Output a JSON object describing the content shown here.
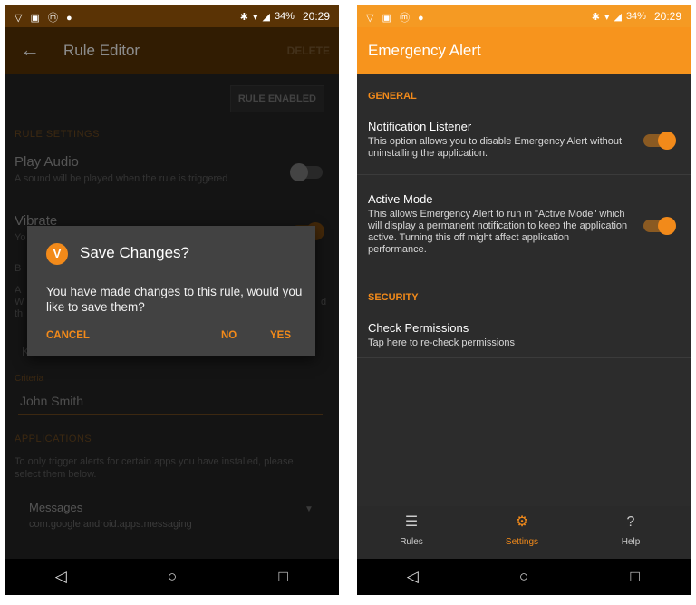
{
  "left": {
    "status": {
      "left_icons": "▽ ▣ ⓜ ●",
      "battery": "34%",
      "time": "20:29"
    },
    "appbar": {
      "title": "Rule Editor",
      "action": "DELETE"
    },
    "rule_enabled": "RULE ENABLED",
    "rule_settings_head": "RULE SETTINGS",
    "play_audio": {
      "title": "Play Audio",
      "sub": "A sound will be played when the rule is triggered"
    },
    "vibrate": {
      "title": "Vibrate"
    },
    "criteria": {
      "label": "Criteria",
      "value": "John Smith"
    },
    "applications": {
      "head": "APPLICATIONS",
      "desc": "To only trigger alerts for certain apps you have installed, please select them below."
    },
    "app_item": {
      "name": "Messages",
      "package": "com.google.android.apps.messaging"
    },
    "dialog": {
      "title": "Save Changes?",
      "message": "You have made changes to this rule, would you like to save them?",
      "cancel": "CANCEL",
      "no": "NO",
      "yes": "YES"
    },
    "partial": {
      "vibrate_sub": "Yo",
      "b": "B",
      "a": "A",
      "w": "W",
      "th": "th",
      "k": "K",
      "d": "d"
    }
  },
  "right": {
    "status": {
      "left_icons": "▽ ▣ ⓜ ●",
      "battery": "34%",
      "time": "20:29"
    },
    "appbar": {
      "title": "Emergency Alert"
    },
    "general_head": "GENERAL",
    "notification_listener": {
      "title": "Notification Listener",
      "desc": "This option allows you to disable Emergency Alert without uninstalling the application."
    },
    "active_mode": {
      "title": "Active Mode",
      "desc": "This allows Emergency Alert to run in \"Active Mode\" which will display a permanent notification to keep the application active. Turning this off might affect application performance."
    },
    "security_head": "SECURITY",
    "check_permissions": {
      "title": "Check Permissions",
      "desc": "Tap here to re-check permissions"
    },
    "bottom_nav": [
      {
        "label": "Rules",
        "icon": "list-icon"
      },
      {
        "label": "Settings",
        "icon": "gear-icon"
      },
      {
        "label": "Help",
        "icon": "help-icon"
      }
    ]
  },
  "colors": {
    "accent": "#f28a1a",
    "appbar_right": "#f7941d",
    "appbar_left": "#5a3305"
  }
}
